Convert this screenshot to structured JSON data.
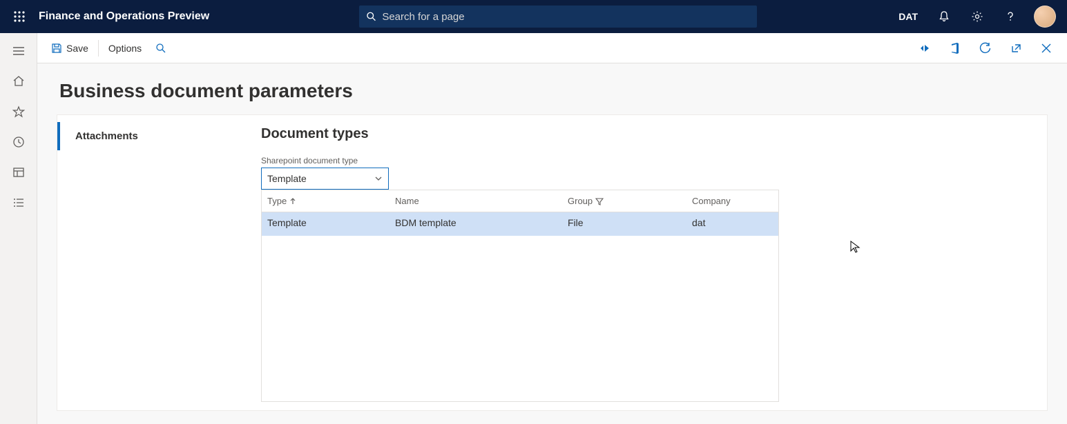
{
  "app": {
    "title": "Finance and Operations Preview"
  },
  "search": {
    "placeholder": "Search for a page"
  },
  "entity": "DAT",
  "commandbar": {
    "save": "Save",
    "options": "Options"
  },
  "page": {
    "title": "Business document parameters"
  },
  "tabs": [
    {
      "label": "Attachments"
    }
  ],
  "section": {
    "title": "Document types",
    "field_label": "Sharepoint document type",
    "combo_value": "Template"
  },
  "grid": {
    "columns": {
      "type": "Type",
      "name": "Name",
      "group": "Group",
      "company": "Company"
    },
    "rows": [
      {
        "type": "Template",
        "name": "BDM template",
        "group": "File",
        "company": "dat"
      }
    ]
  }
}
